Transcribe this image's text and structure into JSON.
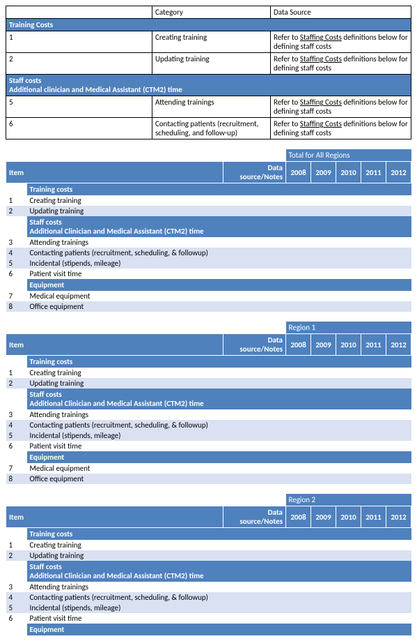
{
  "top_table": {
    "headers": {
      "category": "Category",
      "data_source": "Data Source"
    },
    "training_costs_header": "Training Costs",
    "staff_costs_header": "Staff costs",
    "staff_costs_sub": "Additional clinician and Medical Assistant (CTM2) time",
    "rows": [
      {
        "num": "1",
        "category": "Creating training",
        "ds_prefix": "Refer to ",
        "ds_link": "Staffing Costs",
        "ds_suffix": " definitions below for defining staff costs"
      },
      {
        "num": "2",
        "category": "Updating training",
        "ds_prefix": "Refer to ",
        "ds_link": "Staffing Costs",
        "ds_suffix": " definitions below for defining staff costs"
      },
      {
        "num": "5",
        "category": "Attending trainings",
        "ds_prefix": "Refer to ",
        "ds_link": "Staffing Costs",
        "ds_suffix": " definitions below for defining staff costs"
      },
      {
        "num": "6",
        "category": "Contacting patients (recruitment, scheduling, and follow-up)",
        "ds_prefix": "Refer to ",
        "ds_link": "Staffing Costs",
        "ds_suffix": " definitions below for defining staff costs"
      }
    ]
  },
  "region_tables": {
    "header": {
      "item": "Item",
      "notes": "Data source/Notes",
      "years": [
        "2008",
        "2009",
        "2010",
        "2011",
        "2012"
      ]
    },
    "sections": {
      "training": "Training costs",
      "staff": "Staff costs",
      "staff_sub": "Additional Clinician and Medical Assistant (CTM2) time",
      "equipment": "Equipment"
    },
    "rows": {
      "r1": {
        "num": "1",
        "label": "Creating training"
      },
      "r2": {
        "num": "2",
        "label": "Updating training"
      },
      "r3": {
        "num": "3",
        "label": "Attending trainings"
      },
      "r4": {
        "num": "4",
        "label": "Contacting patients (recruitment, scheduling, & followup)"
      },
      "r5": {
        "num": "5",
        "label": "Incidental (stipends, mileage)"
      },
      "r6": {
        "num": "6",
        "label": "Patient visit time"
      },
      "r7": {
        "num": "7",
        "label": "Medical equipment"
      },
      "r8": {
        "num": "8",
        "label": "Office equipment"
      }
    },
    "titles": {
      "all": "Total for All Regions",
      "r1": "Region 1",
      "r2": "Region 2"
    }
  }
}
